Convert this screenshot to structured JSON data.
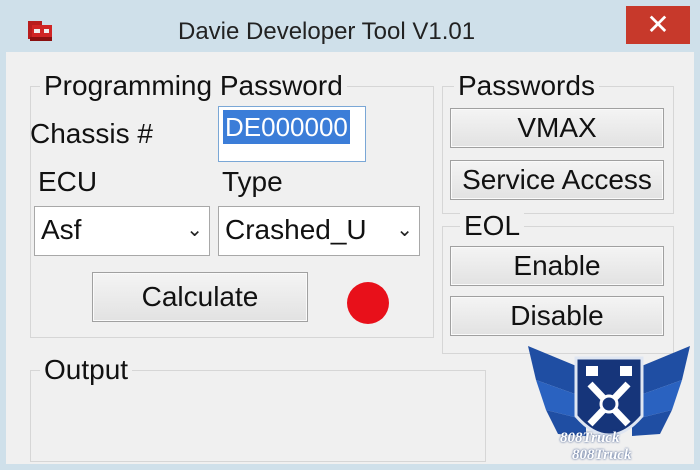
{
  "window": {
    "title": "Davie Developer Tool V1.01",
    "close_label": "✕",
    "colors": {
      "titlebar": "#cfe0ea",
      "close": "#c7392b",
      "led": "#e8101a",
      "selection": "#3b7dd8"
    }
  },
  "programming": {
    "legend": "Programming Password",
    "chassis_label": "Chassis #",
    "chassis_value": "DE000000",
    "ecu_label": "ECU",
    "ecu_selected": "Asf",
    "type_label": "Type",
    "type_selected": "Crashed_U",
    "calculate_label": "Calculate",
    "status_led": "red-status-indicator"
  },
  "passwords": {
    "legend": "Passwords",
    "vmax_label": "VMAX",
    "service_label": "Service Access"
  },
  "eol": {
    "legend": "EOL",
    "enable_label": "Enable",
    "disable_label": "Disable"
  },
  "output": {
    "legend": "Output"
  },
  "watermark": {
    "line1": "808Truck",
    "line2": "808Truck",
    "icon": "winged-shield-wrench-logo"
  }
}
